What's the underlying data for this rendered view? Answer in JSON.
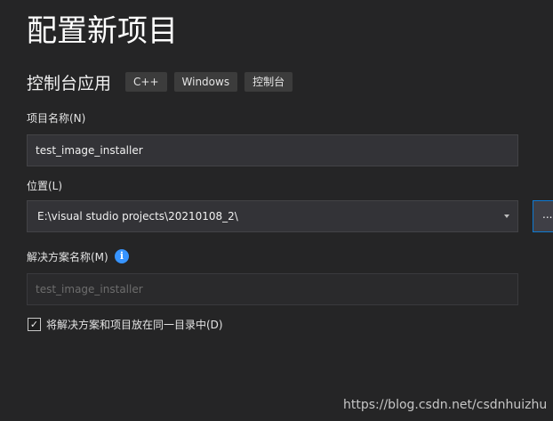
{
  "header": {
    "title": "配置新项目"
  },
  "project": {
    "type_name": "控制台应用",
    "tags": [
      "C++",
      "Windows",
      "控制台"
    ]
  },
  "form": {
    "project_name": {
      "label": "项目名称(N)",
      "value": "test_image_installer"
    },
    "location": {
      "label": "位置(L)",
      "value": "E:\\visual studio projects\\20210108_2\\",
      "browse_label": "..."
    },
    "solution_name": {
      "label": "解决方案名称(M)",
      "info_glyph": "i",
      "placeholder": "test_image_installer"
    },
    "same_dir": {
      "checked": true,
      "check_glyph": "✓",
      "label": "将解决方案和项目放在同一目录中(D)"
    }
  },
  "watermark": {
    "text": "https://blog.csdn.net/csdnhuizhu"
  },
  "icons": {
    "info": "info-icon",
    "dropdown": "chevron-down-icon",
    "check": "check-icon"
  },
  "colors": {
    "background": "#252526",
    "input_bg": "#333337",
    "accent": "#0e7ad3",
    "info_blue": "#3794ff"
  }
}
